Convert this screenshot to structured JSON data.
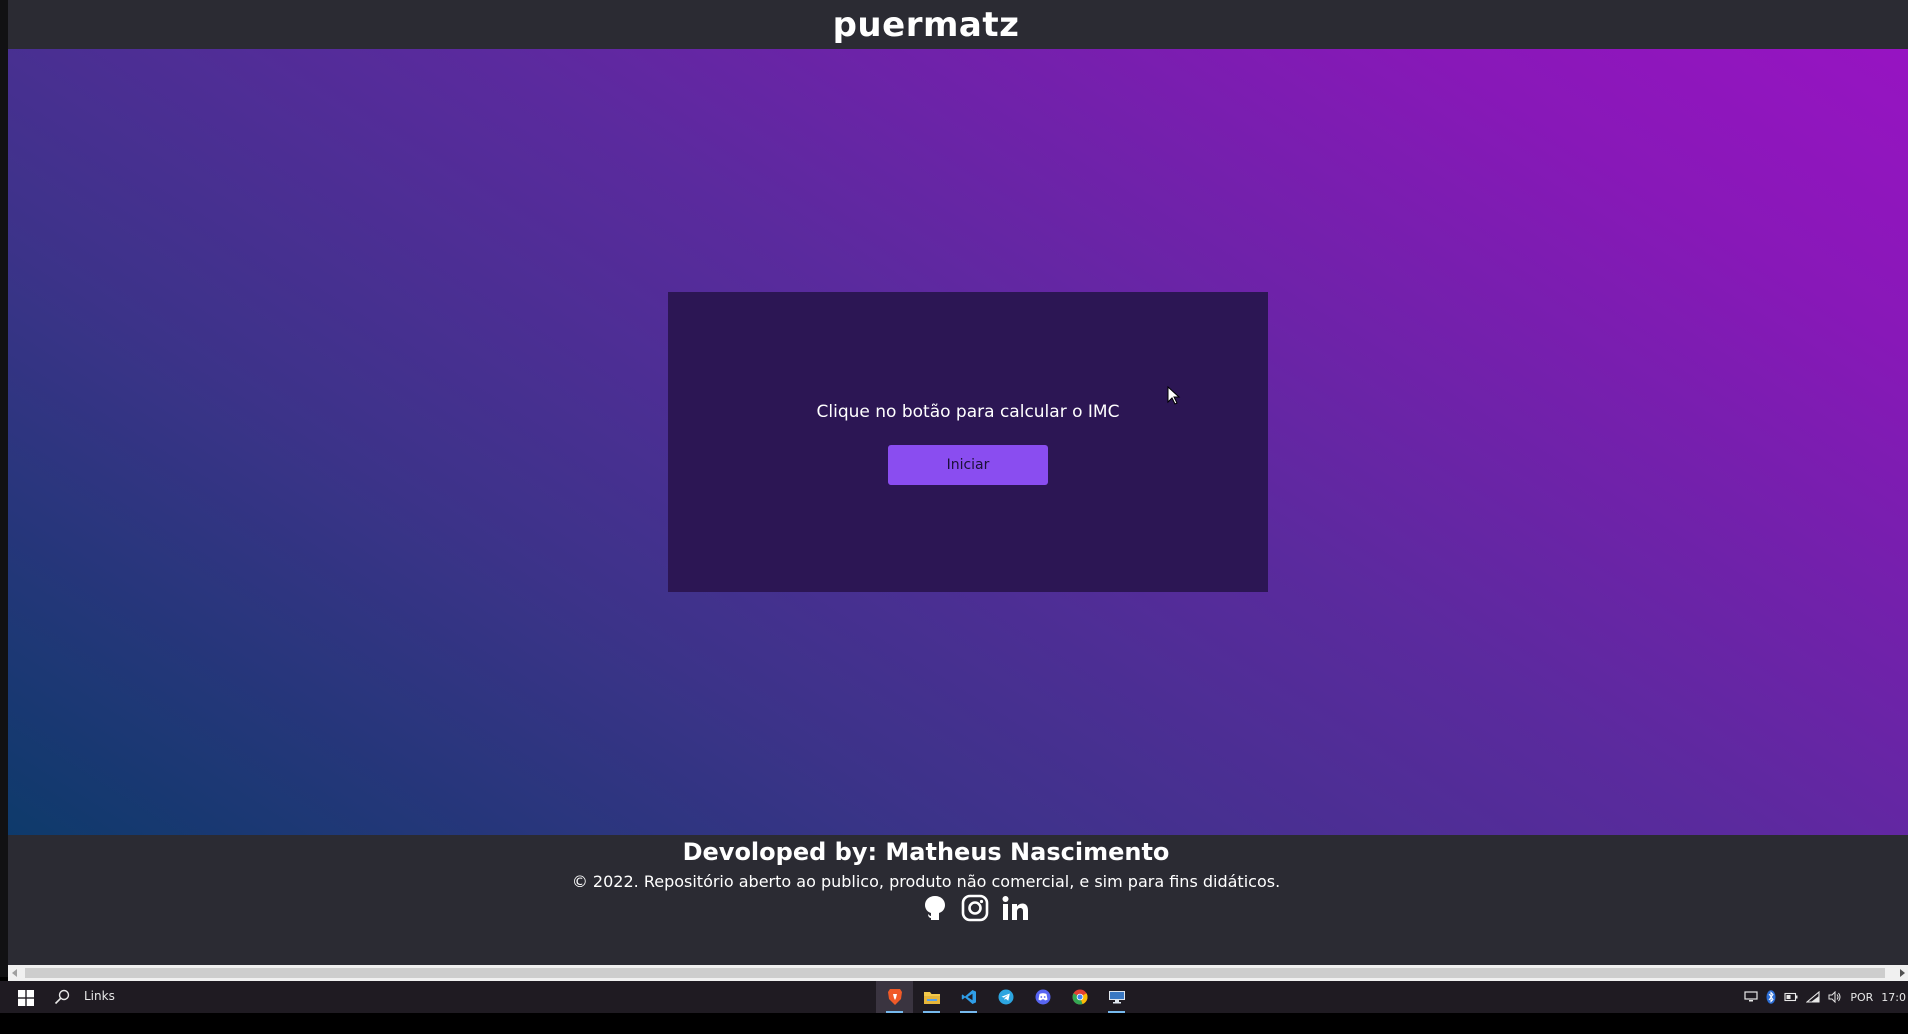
{
  "header": {
    "title": "puermatz"
  },
  "card": {
    "prompt": "Clique no botão para calcular o IMC",
    "start_label": "Iniciar"
  },
  "footer": {
    "developer": "Devoloped by: Matheus Nascimento",
    "copyright": "© 2022. Repositório aberto ao publico, produto não comercial, e sim para fins didáticos.",
    "social": [
      "github-icon",
      "instagram-icon",
      "linkedin-icon"
    ]
  },
  "taskbar": {
    "search_label": "Links",
    "apps": [
      "brave-icon",
      "file-explorer-icon",
      "vscode-icon",
      "telegram-icon",
      "discord-icon",
      "chrome-icon",
      "remote-desktop-icon"
    ],
    "language": "POR",
    "clock": "17:0"
  },
  "colors": {
    "header_bg": "#2b2b33",
    "card_bg": "#2c1654",
    "button_bg": "#8a4df0",
    "gradient_start": "#0e3a6b",
    "gradient_end": "#9714c2"
  }
}
